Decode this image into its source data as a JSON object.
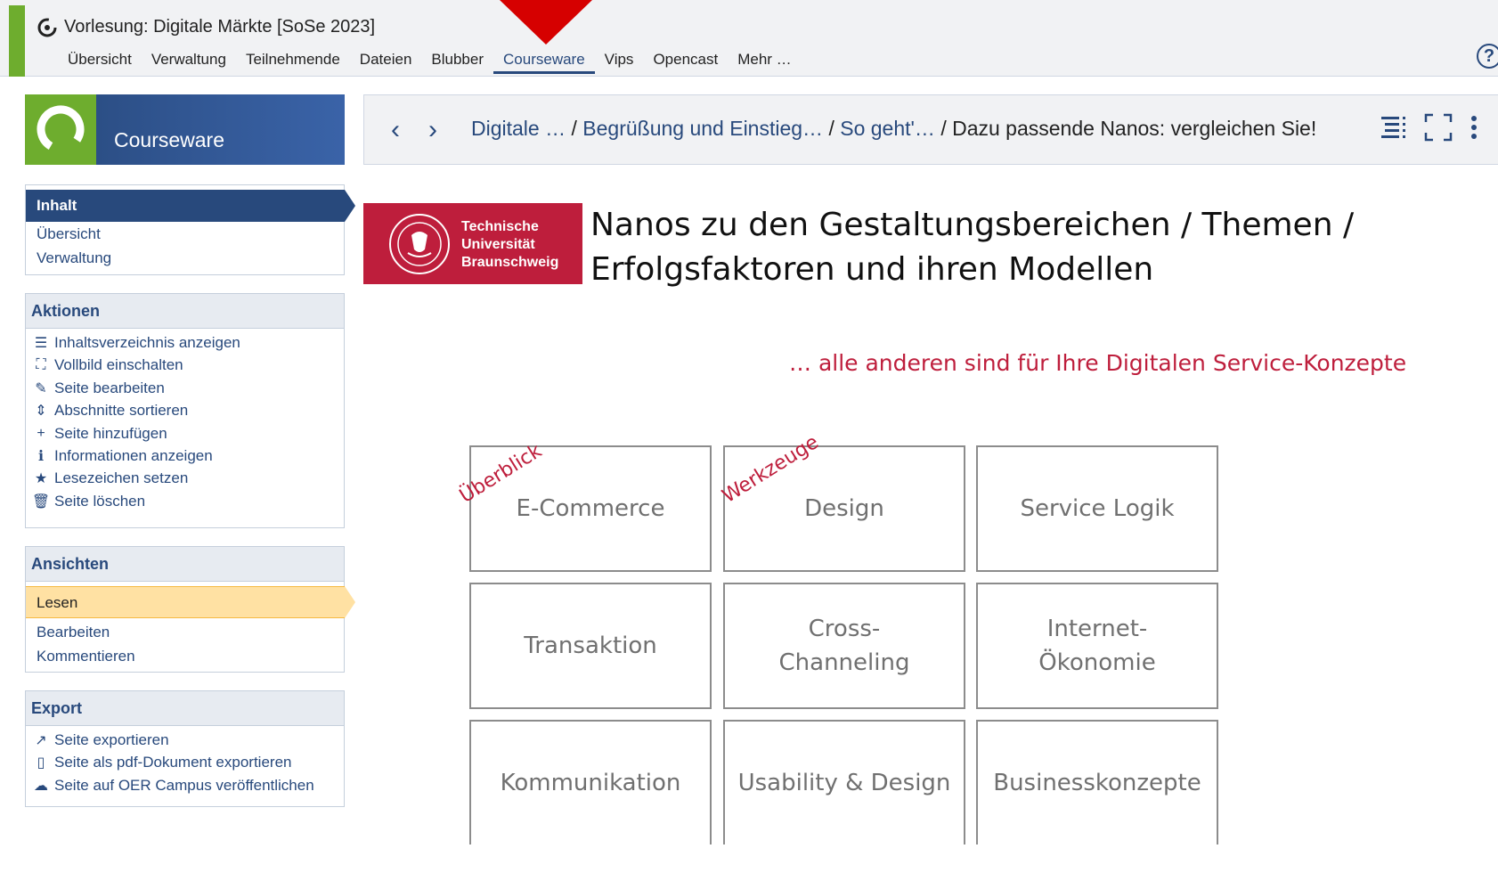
{
  "header": {
    "course_title": "Vorlesung: Digitale Märkte [SoSe 2023]",
    "tabs": [
      {
        "label": "Übersicht",
        "active": false
      },
      {
        "label": "Verwaltung",
        "active": false
      },
      {
        "label": "Teilnehmende",
        "active": false
      },
      {
        "label": "Dateien",
        "active": false
      },
      {
        "label": "Blubber",
        "active": false
      },
      {
        "label": "Courseware",
        "active": true
      },
      {
        "label": "Vips",
        "active": false
      },
      {
        "label": "Opencast",
        "active": false
      },
      {
        "label": "Mehr …",
        "active": false
      }
    ],
    "help_glyph": "?"
  },
  "sidebar": {
    "banner_title": "Courseware",
    "nav": {
      "active_label": "Inhalt",
      "items": [
        "Übersicht",
        "Verwaltung"
      ]
    },
    "actions": {
      "title": "Aktionen",
      "items": [
        {
          "icon": "toc-icon",
          "glyph": "☰",
          "label": "Inhaltsverzeichnis anzeigen"
        },
        {
          "icon": "fullscreen-icon",
          "glyph": "⛶",
          "label": "Vollbild einschalten"
        },
        {
          "icon": "edit-page-icon",
          "glyph": "✎",
          "label": "Seite bearbeiten"
        },
        {
          "icon": "sort-icon",
          "glyph": "⇕",
          "label": "Abschnitte sortieren"
        },
        {
          "icon": "plus-icon",
          "glyph": "+",
          "label": "Seite hinzufügen"
        },
        {
          "icon": "info-icon",
          "glyph": "ℹ",
          "label": "Informationen anzeigen"
        },
        {
          "icon": "star-icon",
          "glyph": "★",
          "label": "Lesezeichen setzen"
        },
        {
          "icon": "trash-icon",
          "glyph": "🗑",
          "label": "Seite löschen"
        }
      ]
    },
    "views": {
      "title": "Ansichten",
      "active_label": "Lesen",
      "items": [
        "Bearbeiten",
        "Kommentieren"
      ]
    },
    "export": {
      "title": "Export",
      "items": [
        {
          "icon": "export-icon",
          "glyph": "↗",
          "label": "Seite exportieren"
        },
        {
          "icon": "pdf-icon",
          "glyph": "▯",
          "label": "Seite als pdf-Dokument exportieren"
        },
        {
          "icon": "oer-campus-icon",
          "glyph": "☁",
          "label": "Seite auf OER Campus veröffentlichen"
        }
      ]
    }
  },
  "breadcrumb": {
    "items": [
      "Digitale …",
      "Begrüßung und Einstieg…",
      "So geht'…"
    ],
    "current": "Dazu passende Nanos: vergleichen Sie!"
  },
  "slide": {
    "logo_lines": [
      "Technische",
      "Universität",
      "Braunschweig"
    ],
    "title_lines": [
      "Nanos zu den Gestaltungsbereichen / Themen /",
      "Erfolgsfaktoren und ihren Modellen"
    ],
    "subtitle": "… alle anderen sind für Ihre Digitalen Service-Konzepte",
    "annotations": [
      "Überblick",
      "Werkzeuge"
    ],
    "boxes": [
      [
        "E-Commerce",
        "Design",
        "Service Logik"
      ],
      [
        "Transaktion",
        "Cross-\nChanneling",
        "Internet-\nÖkonomie"
      ],
      [
        "Kommunikation",
        "Usability & Design",
        "Businesskonzepte"
      ]
    ],
    "accent_color": "#be1e3c"
  }
}
